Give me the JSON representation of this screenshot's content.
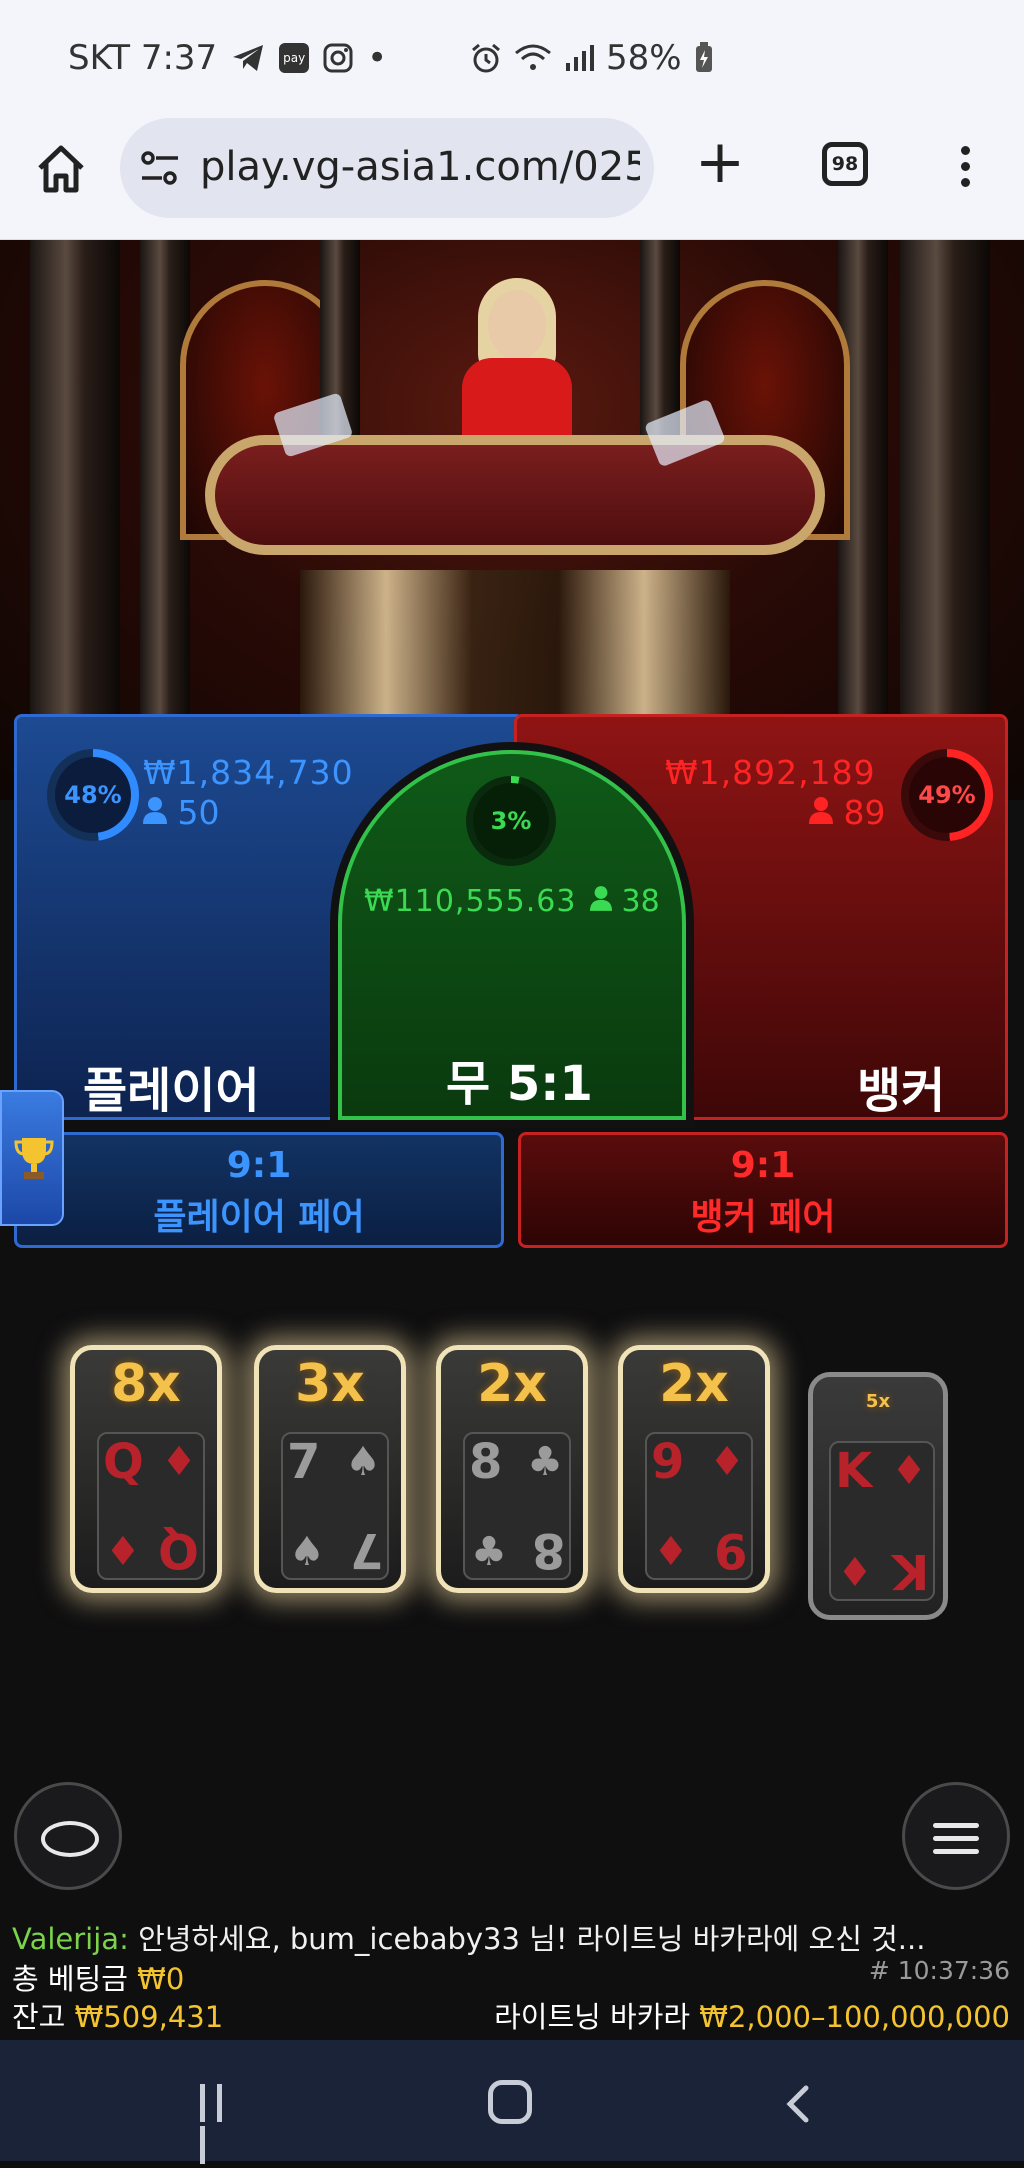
{
  "status_bar": {
    "carrier_time": "SKT 7:37",
    "pay_icon_label": "pay",
    "dot": "•",
    "battery": "58%"
  },
  "browser": {
    "url": "play.vg-asia1.com/025",
    "new_tab_label": "+",
    "tab_count": "98"
  },
  "bets": {
    "player": {
      "percent": "48%",
      "amount": "₩1,834,730",
      "players": "50",
      "label": "플레이어"
    },
    "banker": {
      "percent": "49%",
      "amount": "₩1,892,189",
      "players": "89",
      "label": "뱅커"
    },
    "tie": {
      "percent": "3%",
      "amount": "₩110,555.63",
      "players": "38",
      "label": "무 5:1"
    },
    "player_pair": {
      "odds": "9:1",
      "label": "플레이어 페어"
    },
    "banker_pair": {
      "odds": "9:1",
      "label": "뱅커 페어"
    }
  },
  "lightning_cards": [
    {
      "multiplier": "8x",
      "rank": "Q",
      "suit": "♦",
      "color": "red",
      "lit": true
    },
    {
      "multiplier": "3x",
      "rank": "7",
      "suit": "♠",
      "color": "black",
      "lit": true
    },
    {
      "multiplier": "2x",
      "rank": "8",
      "suit": "♣",
      "color": "black",
      "lit": true
    },
    {
      "multiplier": "2x",
      "rank": "9",
      "suit": "♦",
      "color": "red",
      "lit": true
    },
    {
      "multiplier": "5x",
      "rank": "K",
      "suit": "♦",
      "color": "red",
      "lit": false
    }
  ],
  "chat": {
    "user": "Valerija:",
    "message": "안녕하세요, bum_icebaby33 님! 라이트닝 바카라에 오신 것..."
  },
  "footer": {
    "total_bet_label": "총 베팅금",
    "total_bet_value": "₩0",
    "balance_label": "잔고",
    "balance_value": "₩509,431",
    "round_id": "# 10:37:36",
    "game_name": "라이트닝 바카라",
    "limits": "₩2,000–100,000,000"
  },
  "colors": {
    "player_blue": "#3c94ff",
    "banker_red": "#ff2424",
    "tie_green": "#3adb52",
    "gold": "#f4c430"
  }
}
